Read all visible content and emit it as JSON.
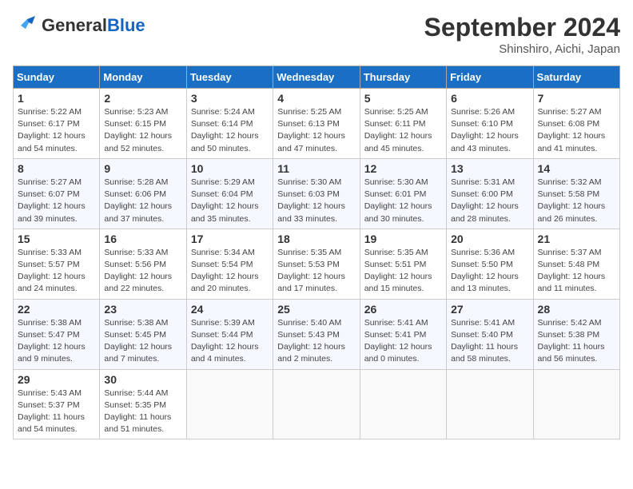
{
  "header": {
    "logo": {
      "general": "General",
      "blue": "Blue"
    },
    "title": "September 2024",
    "subtitle": "Shinshiro, Aichi, Japan"
  },
  "weekdays": [
    "Sunday",
    "Monday",
    "Tuesday",
    "Wednesday",
    "Thursday",
    "Friday",
    "Saturday"
  ],
  "weeks": [
    [
      {
        "day": "1",
        "sunrise": "5:22 AM",
        "sunset": "6:17 PM",
        "daylight": "12 hours and 54 minutes."
      },
      {
        "day": "2",
        "sunrise": "5:23 AM",
        "sunset": "6:15 PM",
        "daylight": "12 hours and 52 minutes."
      },
      {
        "day": "3",
        "sunrise": "5:24 AM",
        "sunset": "6:14 PM",
        "daylight": "12 hours and 50 minutes."
      },
      {
        "day": "4",
        "sunrise": "5:25 AM",
        "sunset": "6:13 PM",
        "daylight": "12 hours and 47 minutes."
      },
      {
        "day": "5",
        "sunrise": "5:25 AM",
        "sunset": "6:11 PM",
        "daylight": "12 hours and 45 minutes."
      },
      {
        "day": "6",
        "sunrise": "5:26 AM",
        "sunset": "6:10 PM",
        "daylight": "12 hours and 43 minutes."
      },
      {
        "day": "7",
        "sunrise": "5:27 AM",
        "sunset": "6:08 PM",
        "daylight": "12 hours and 41 minutes."
      }
    ],
    [
      {
        "day": "8",
        "sunrise": "5:27 AM",
        "sunset": "6:07 PM",
        "daylight": "12 hours and 39 minutes."
      },
      {
        "day": "9",
        "sunrise": "5:28 AM",
        "sunset": "6:06 PM",
        "daylight": "12 hours and 37 minutes."
      },
      {
        "day": "10",
        "sunrise": "5:29 AM",
        "sunset": "6:04 PM",
        "daylight": "12 hours and 35 minutes."
      },
      {
        "day": "11",
        "sunrise": "5:30 AM",
        "sunset": "6:03 PM",
        "daylight": "12 hours and 33 minutes."
      },
      {
        "day": "12",
        "sunrise": "5:30 AM",
        "sunset": "6:01 PM",
        "daylight": "12 hours and 30 minutes."
      },
      {
        "day": "13",
        "sunrise": "5:31 AM",
        "sunset": "6:00 PM",
        "daylight": "12 hours and 28 minutes."
      },
      {
        "day": "14",
        "sunrise": "5:32 AM",
        "sunset": "5:58 PM",
        "daylight": "12 hours and 26 minutes."
      }
    ],
    [
      {
        "day": "15",
        "sunrise": "5:33 AM",
        "sunset": "5:57 PM",
        "daylight": "12 hours and 24 minutes."
      },
      {
        "day": "16",
        "sunrise": "5:33 AM",
        "sunset": "5:56 PM",
        "daylight": "12 hours and 22 minutes."
      },
      {
        "day": "17",
        "sunrise": "5:34 AM",
        "sunset": "5:54 PM",
        "daylight": "12 hours and 20 minutes."
      },
      {
        "day": "18",
        "sunrise": "5:35 AM",
        "sunset": "5:53 PM",
        "daylight": "12 hours and 17 minutes."
      },
      {
        "day": "19",
        "sunrise": "5:35 AM",
        "sunset": "5:51 PM",
        "daylight": "12 hours and 15 minutes."
      },
      {
        "day": "20",
        "sunrise": "5:36 AM",
        "sunset": "5:50 PM",
        "daylight": "12 hours and 13 minutes."
      },
      {
        "day": "21",
        "sunrise": "5:37 AM",
        "sunset": "5:48 PM",
        "daylight": "12 hours and 11 minutes."
      }
    ],
    [
      {
        "day": "22",
        "sunrise": "5:38 AM",
        "sunset": "5:47 PM",
        "daylight": "12 hours and 9 minutes."
      },
      {
        "day": "23",
        "sunrise": "5:38 AM",
        "sunset": "5:45 PM",
        "daylight": "12 hours and 7 minutes."
      },
      {
        "day": "24",
        "sunrise": "5:39 AM",
        "sunset": "5:44 PM",
        "daylight": "12 hours and 4 minutes."
      },
      {
        "day": "25",
        "sunrise": "5:40 AM",
        "sunset": "5:43 PM",
        "daylight": "12 hours and 2 minutes."
      },
      {
        "day": "26",
        "sunrise": "5:41 AM",
        "sunset": "5:41 PM",
        "daylight": "12 hours and 0 minutes."
      },
      {
        "day": "27",
        "sunrise": "5:41 AM",
        "sunset": "5:40 PM",
        "daylight": "11 hours and 58 minutes."
      },
      {
        "day": "28",
        "sunrise": "5:42 AM",
        "sunset": "5:38 PM",
        "daylight": "11 hours and 56 minutes."
      }
    ],
    [
      {
        "day": "29",
        "sunrise": "5:43 AM",
        "sunset": "5:37 PM",
        "daylight": "11 hours and 54 minutes."
      },
      {
        "day": "30",
        "sunrise": "5:44 AM",
        "sunset": "5:35 PM",
        "daylight": "11 hours and 51 minutes."
      },
      null,
      null,
      null,
      null,
      null
    ]
  ]
}
